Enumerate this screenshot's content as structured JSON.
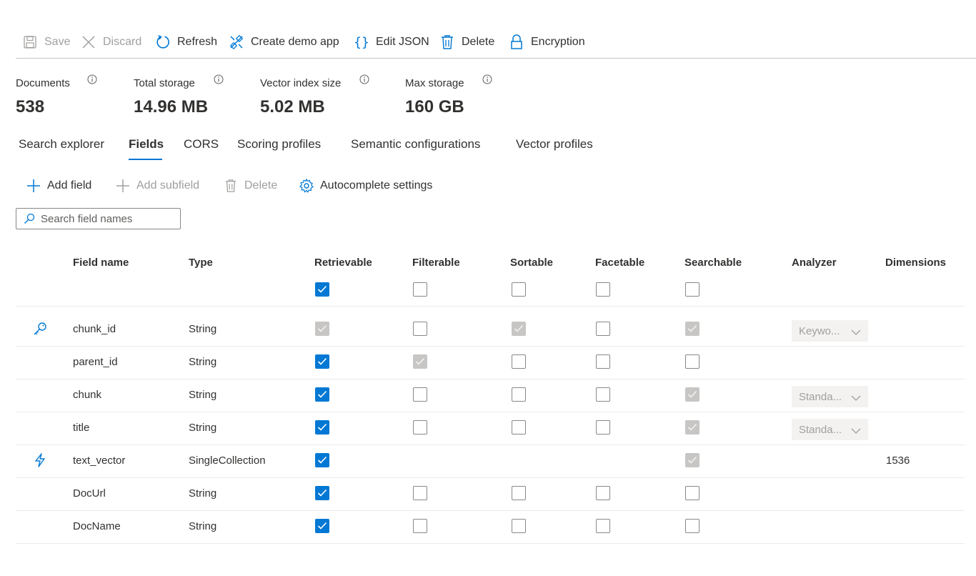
{
  "toolbar": {
    "save": "Save",
    "discard": "Discard",
    "refresh": "Refresh",
    "create_demo_app": "Create demo app",
    "edit_json": "Edit JSON",
    "delete": "Delete",
    "encryption": "Encryption"
  },
  "stats": {
    "documents": {
      "label": "Documents",
      "value": "538"
    },
    "total_storage": {
      "label": "Total storage",
      "value": "14.96 MB"
    },
    "vector_index_size": {
      "label": "Vector index size",
      "value": "5.02 MB"
    },
    "max_storage": {
      "label": "Max storage",
      "value": "160 GB"
    }
  },
  "tabs": [
    "Search explorer",
    "Fields",
    "CORS",
    "Scoring profiles",
    "Semantic configurations",
    "Vector profiles"
  ],
  "active_tab": "Fields",
  "commands": {
    "add_field": "Add field",
    "add_subfield": "Add subfield",
    "delete": "Delete",
    "autocomplete_settings": "Autocomplete settings"
  },
  "search": {
    "placeholder": "Search field names",
    "value": ""
  },
  "columns": [
    "Field name",
    "Type",
    "Retrievable",
    "Filterable",
    "Sortable",
    "Facetable",
    "Searchable",
    "Analyzer",
    "Dimensions"
  ],
  "header_checks": {
    "retrievable": "checked",
    "filterable": "unchecked",
    "sortable": "unchecked",
    "facetable": "unchecked",
    "searchable": "unchecked"
  },
  "rows": [
    {
      "icon": "key-icon",
      "name": "chunk_id",
      "type": "String",
      "retrievable": "checked-disabled",
      "filterable": "unchecked",
      "sortable": "checked-disabled",
      "facetable": "unchecked",
      "searchable": "checked-disabled",
      "analyzer": "Keywo...",
      "dimensions": ""
    },
    {
      "icon": "",
      "name": "parent_id",
      "type": "String",
      "retrievable": "checked",
      "filterable": "checked-disabled",
      "sortable": "unchecked",
      "facetable": "unchecked",
      "searchable": "unchecked",
      "analyzer": "",
      "dimensions": ""
    },
    {
      "icon": "",
      "name": "chunk",
      "type": "String",
      "retrievable": "checked",
      "filterable": "unchecked",
      "sortable": "unchecked",
      "facetable": "unchecked",
      "searchable": "checked-disabled",
      "analyzer": "Standa...",
      "dimensions": ""
    },
    {
      "icon": "",
      "name": "title",
      "type": "String",
      "retrievable": "checked",
      "filterable": "unchecked",
      "sortable": "unchecked",
      "facetable": "unchecked",
      "searchable": "checked-disabled",
      "analyzer": "Standa...",
      "dimensions": ""
    },
    {
      "icon": "lightning-icon",
      "name": "text_vector",
      "type": "SingleCollection",
      "retrievable": "checked",
      "filterable": "none",
      "sortable": "none",
      "facetable": "none",
      "searchable": "checked-disabled",
      "analyzer": "",
      "dimensions": "1536"
    },
    {
      "icon": "",
      "name": "DocUrl",
      "type": "String",
      "retrievable": "checked",
      "filterable": "unchecked",
      "sortable": "unchecked",
      "facetable": "unchecked",
      "searchable": "unchecked",
      "analyzer": "",
      "dimensions": ""
    },
    {
      "icon": "",
      "name": "DocName",
      "type": "String",
      "retrievable": "checked",
      "filterable": "unchecked",
      "sortable": "unchecked",
      "facetable": "unchecked",
      "searchable": "unchecked",
      "analyzer": "",
      "dimensions": ""
    }
  ],
  "colors": {
    "accent": "#0078d4",
    "disabled_check": "#c8c6c4",
    "text": "#323130",
    "disabled_text": "#a19f9d"
  }
}
